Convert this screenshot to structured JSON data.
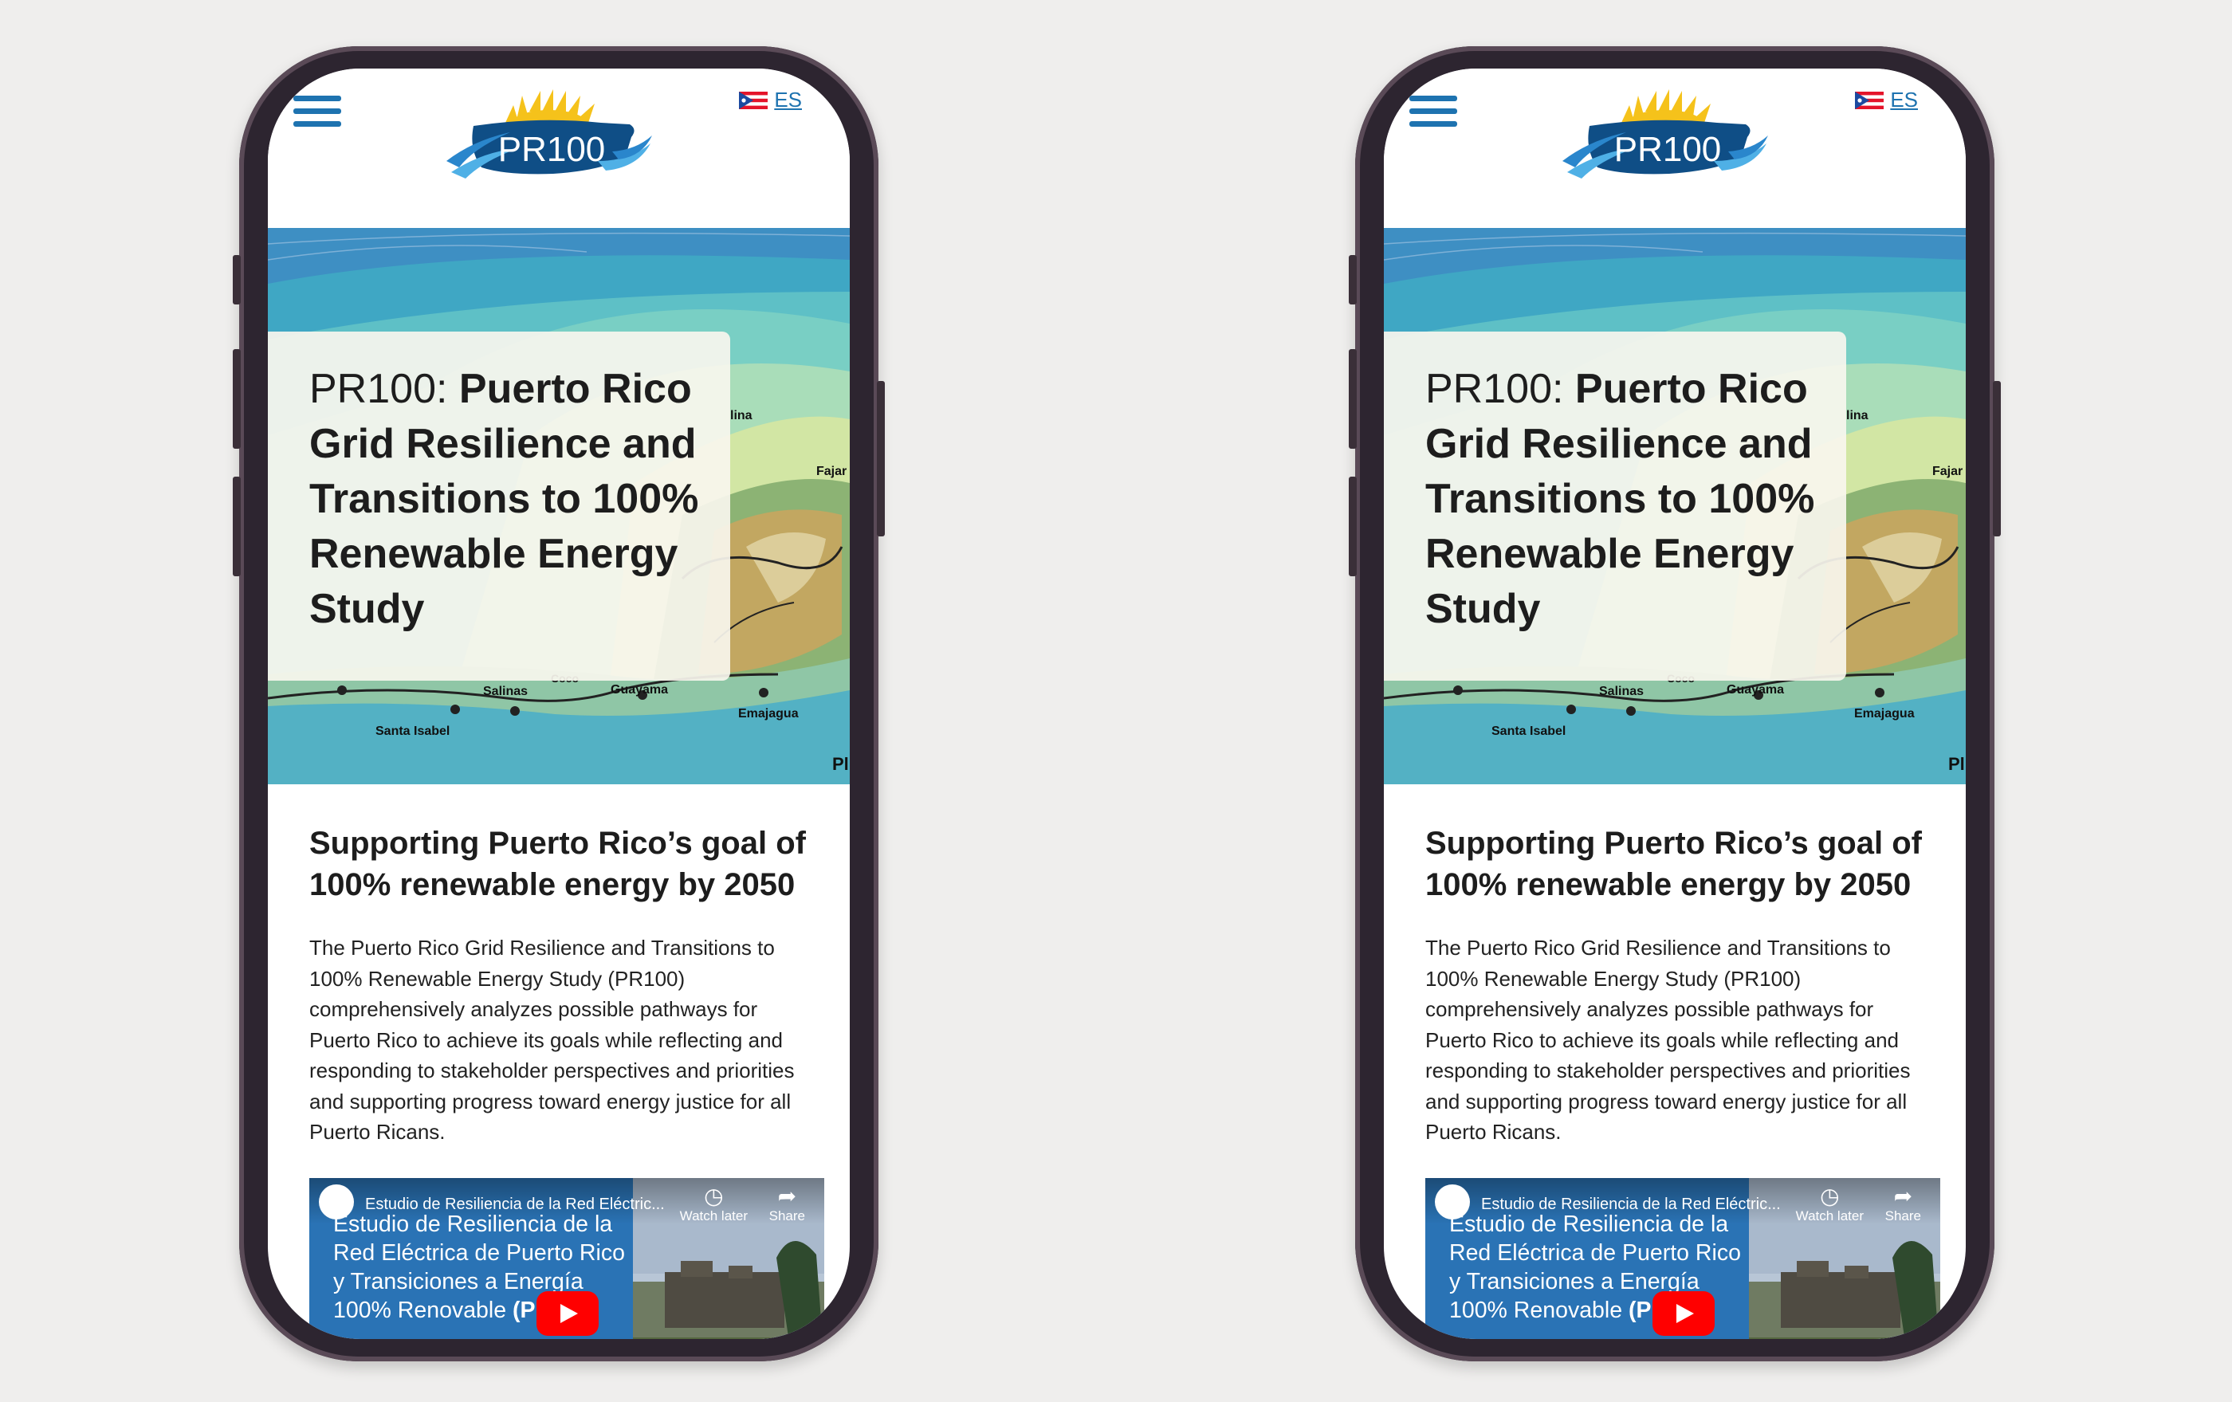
{
  "phones": [
    {
      "header": {
        "language_link": "ES",
        "logo_text": "PR100"
      },
      "hero": {
        "title_prefix": "PR100: ",
        "title_main": "Puerto Rico Grid Resilience and Transitions to 100% Renewable Energy Study",
        "map_labels": [
          "Salinas",
          "Guayama",
          "Santa Isabel",
          "Emajagua",
          "Fajar",
          "lina",
          "Coco",
          "Pl"
        ]
      },
      "content": {
        "subheading": "Supporting Puerto Rico’s goal of 100% renewable energy by 2050",
        "body": "The Puerto Rico Grid Resilience and Transitions to 100% Renewable Energy Study (PR100) comprehensively analyzes possible pathways for Puerto Rico to achieve its goals while reflecting and responding to stakeholder perspectives and priorities and supporting progress toward energy justice for all Puerto Ricans."
      },
      "video": {
        "title": "Estudio de Resiliencia de la Red Eléctric...",
        "watch_later": "Watch later",
        "share": "Share",
        "overlay_text_normal": "Estudio de Resiliencia de la Red Eléctrica de Puerto Rico y Transiciones a Energía 100% Renovable ",
        "overlay_text_bold": "(PR"
      }
    },
    {
      "header": {
        "language_link": "ES",
        "logo_text": "PR100"
      },
      "hero": {
        "title_prefix": "PR100: ",
        "title_main": "Puerto Rico Grid Resilience and Transitions to 100% Renewable Energy Study",
        "map_labels": [
          "Salinas",
          "Guayama",
          "Santa Isabel",
          "Emajagua",
          "Fajar",
          "lina",
          "Coco",
          "Pl"
        ]
      },
      "content": {
        "subheading": "Supporting Puerto Rico’s goal of 100% renewable energy by 2050",
        "body": "The Puerto Rico Grid Resilience and Transitions to 100% Renewable Energy Study (PR100) comprehensively analyzes possible pathways for Puerto Rico to achieve its goals while reflecting and responding to stakeholder perspectives and priorities and supporting progress toward energy justice for all Puerto Ricans."
      },
      "video": {
        "title": "Estudio de Resiliencia de la Red Eléctric...",
        "watch_later": "Watch later",
        "share": "Share",
        "overlay_text_normal": "Estudio de Resiliencia de la Red Eléctrica de Puerto Rico y Transiciones a Energía 100% Renovable ",
        "overlay_text_bold": "(PR"
      }
    }
  ],
  "colors": {
    "background": "#efeeed",
    "phone_frame": "#2d2530",
    "brand_blue": "#1e73b0",
    "logo_navy": "#0f4e86",
    "sun_yellow": "#f5c21b",
    "youtube_red": "#ff0000"
  },
  "icons": [
    "hamburger-menu-icon",
    "puerto-rico-flag-icon",
    "clock-icon",
    "share-icon",
    "play-icon"
  ]
}
